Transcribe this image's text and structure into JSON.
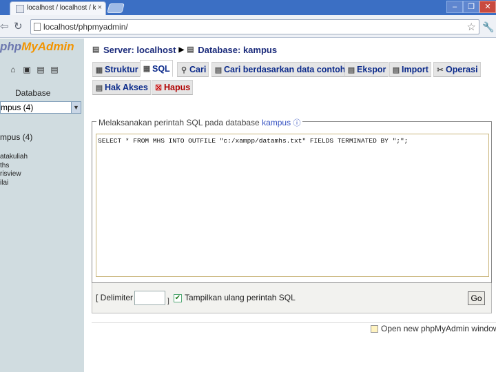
{
  "browser": {
    "tab_title": "localhost / localhost / kampus",
    "tab_close": "×",
    "url": "localhost/phpmyadmin/",
    "win_min": "–",
    "win_max": "❐",
    "win_close": "✕",
    "back_icon": "arrow-left-icon",
    "reload_icon": "reload-icon",
    "star_icon": "star-icon",
    "wrench_icon": "wrench-icon"
  },
  "sidebar": {
    "logo_php": "php",
    "logo_my": "My",
    "logo_admin": "Admin",
    "database_label": "Database",
    "database_select_value": "mpus (4)",
    "database_heading": "mpus (4)",
    "tables": [
      "atakuliah",
      "ths",
      "risview",
      "ilai"
    ]
  },
  "breadcrumb": {
    "server": "Server: localhost",
    "database": "Database: kampus"
  },
  "tabs": [
    {
      "label": "Struktur"
    },
    {
      "label": "SQL"
    },
    {
      "label": "Cari"
    },
    {
      "label": "Cari berdasarkan data contoh"
    },
    {
      "label": "Ekspor"
    },
    {
      "label": "Import"
    },
    {
      "label": "Operasi"
    },
    {
      "label": "Hak Akses"
    },
    {
      "label": "Hapus"
    }
  ],
  "sql_panel": {
    "legend": "Melaksanakan perintah SQL pada database",
    "legend_db": "kampus",
    "query": "SELECT * FROM MHS INTO OUTFILE \"c:/xampp/datamhs.txt\" FIELDS TERMINATED BY \";\";",
    "delimiter_label": "[ Delimiter",
    "delimiter_value": "",
    "delimiter_suffix": "]",
    "show_again_label": "Tampilkan ulang perintah SQL",
    "show_again_checked": true,
    "go_label": "Go"
  },
  "footer": {
    "new_window_label": "Open new phpMyAdmin window"
  }
}
